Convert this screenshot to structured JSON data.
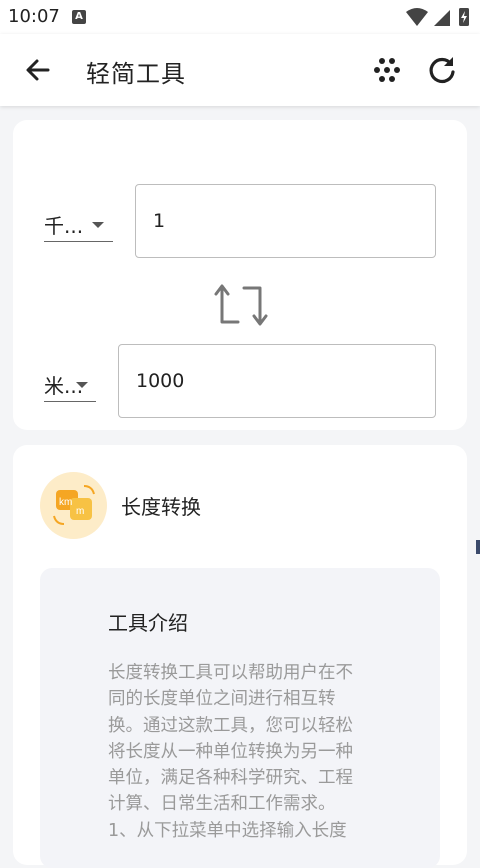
{
  "status_bar": {
    "time": "10:07",
    "badge": "A"
  },
  "app_bar": {
    "title": "轻简工具"
  },
  "converter": {
    "from_unit": "千...",
    "from_value": "1",
    "to_unit": "米...",
    "to_value": "1000"
  },
  "tool_card": {
    "name": "长度转换",
    "intro_title": "工具介绍",
    "intro_text": "长度转换工具可以帮助用户在不\n同的长度单位之间进行相互转\n换。通过这款工具，您可以轻松\n将长度从一种单位转换为另一种\n单位，满足各种科学研究、工程\n计算、日常生活和工作需求。\n1、从下拉菜单中选择输入长度"
  },
  "colors": {
    "accent_icon_bg": "#fdecc8",
    "icon_orange": "#f5a623",
    "background": "#f4f5f7"
  }
}
